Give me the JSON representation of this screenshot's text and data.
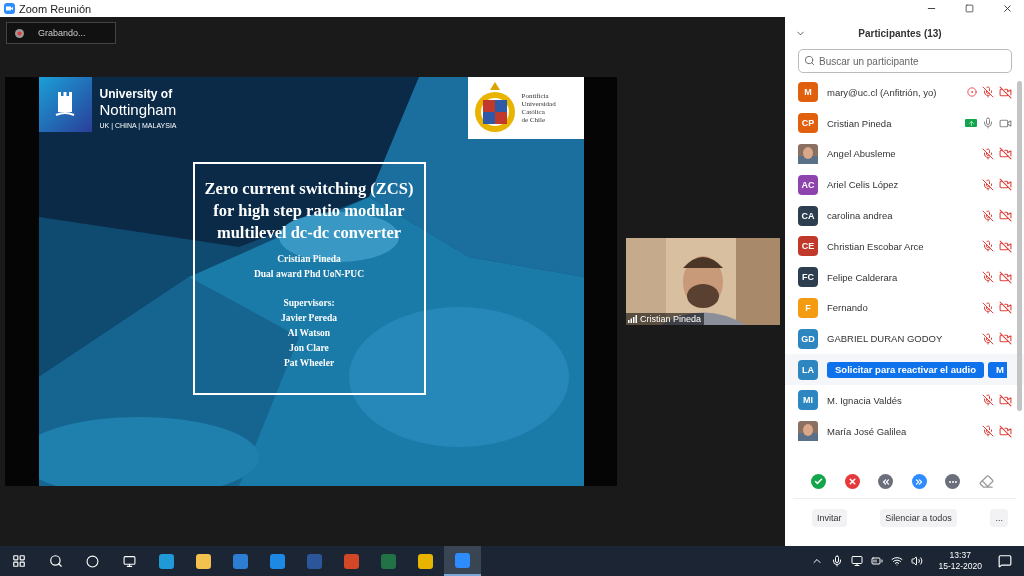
{
  "window": {
    "title": "Zoom Reunión"
  },
  "recording": {
    "label": "Grabando..."
  },
  "slide": {
    "nottingham": {
      "line1": "University of",
      "line2": "Nottingham",
      "line3": "UK | CHINA | MALAYSIA"
    },
    "puc": {
      "lines": [
        "Pontificia",
        "Universidad",
        "Católica",
        "de Chile"
      ]
    },
    "title": "Zero current switching (ZCS) for high step ratio modular multilevel dc-dc converter",
    "author": [
      "Cristian Pineda",
      "Dual award Phd UoN-PUC"
    ],
    "supervisors_heading": "Supervisors:",
    "supervisors": [
      "Javier Pereda",
      "Al Watson",
      "Jon Clare",
      "Pat Wheeler"
    ]
  },
  "video": {
    "name": "Cristian Pineda"
  },
  "panel": {
    "title": "Participantes (13)",
    "search_placeholder": "Buscar un participante",
    "participants": [
      {
        "name": "mary@uc.cl (Anfitrión, yo)",
        "kind": "initials",
        "initials": "M",
        "color": "#e0600e",
        "recording": true,
        "sharing": false,
        "mic_muted": true,
        "video_off": true
      },
      {
        "name": "Cristian Pineda",
        "kind": "initials",
        "initials": "CP",
        "color": "#e0600e",
        "recording": false,
        "sharing": true,
        "mic_muted": false,
        "video_off": false
      },
      {
        "name": "Angel Abusleme",
        "recording": false,
        "sharing": false,
        "mic_muted": true,
        "video_off": true
      },
      {
        "name": "Ariel Celis López",
        "kind": "initials",
        "initials": "AC",
        "color": "#8e44ad",
        "recording": false,
        "sharing": false,
        "mic_muted": true,
        "video_off": true
      },
      {
        "name": "carolina andrea",
        "kind": "initials",
        "initials": "CA",
        "color": "#2c3e50",
        "recording": false,
        "sharing": false,
        "mic_muted": true,
        "video_off": true
      },
      {
        "name": "Christian Escobar Arce",
        "kind": "initials",
        "initials": "CE",
        "color": "#c0392b",
        "recording": false,
        "sharing": false,
        "mic_muted": true,
        "video_off": true
      },
      {
        "name": "Felipe Calderara",
        "kind": "initials",
        "initials": "FC",
        "color": "#2c3e50",
        "recording": false,
        "sharing": false,
        "mic_muted": true,
        "video_off": true
      },
      {
        "name": "Fernando",
        "kind": "initials",
        "initials": "F",
        "color": "#f39c12",
        "recording": false,
        "sharing": false,
        "mic_muted": true,
        "video_off": true
      },
      {
        "name": "GABRIEL DURAN GODOY",
        "kind": "initials",
        "initials": "GD",
        "color": "#2e86c1",
        "recording": false,
        "sharing": false,
        "mic_muted": true,
        "video_off": true
      },
      {
        "kind": "initials",
        "initials": "LA",
        "color": "#2e86c1",
        "recording": false,
        "sharing": false,
        "actions": [
          "Solicitar para reactivar el audio",
          "M"
        ]
      },
      {
        "name": "M. Ignacia Valdés",
        "kind": "initials",
        "initials": "MI",
        "color": "#2e86c1",
        "recording": false,
        "sharing": false,
        "mic_muted": true,
        "video_off": true
      },
      {
        "name": "María José Galilea",
        "recording": false,
        "sharing": false,
        "mic_muted": true,
        "video_off": true
      }
    ],
    "buttons": [
      "Invitar",
      "Silenciar a todos",
      "..."
    ]
  },
  "taskbar": {
    "time": "13:37",
    "date": "15-12-2020"
  }
}
